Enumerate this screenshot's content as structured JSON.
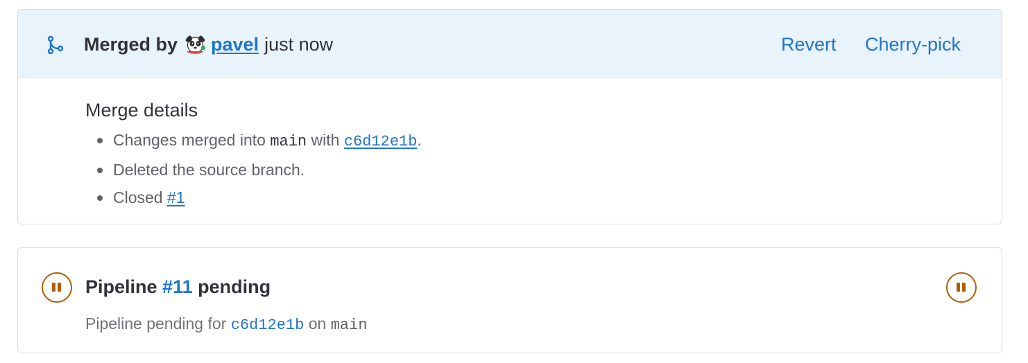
{
  "merged": {
    "label": "Merged by",
    "user": "pavel",
    "time": "just now",
    "actions": {
      "revert": "Revert",
      "cherry_pick": "Cherry-pick"
    }
  },
  "merge_details": {
    "title": "Merge details",
    "item1": {
      "prefix": "Changes merged into",
      "branch": "main",
      "middle": "with",
      "commit": "c6d12e1b",
      "suffix": "."
    },
    "item2": {
      "text": "Deleted the source branch."
    },
    "item3": {
      "prefix": "Closed",
      "issue": "#1"
    }
  },
  "pipeline": {
    "title_prefix": "Pipeline",
    "number": "#11",
    "status": "pending",
    "sub_prefix": "Pipeline pending for",
    "commit": "c6d12e1b",
    "on": "on",
    "branch": "main"
  },
  "colors": {
    "link": "#1f75cb",
    "header_bg": "#e9f3fc",
    "pending": "#b25c00",
    "border": "#dcdcde"
  },
  "icons": {
    "merge": "merge-request-icon",
    "pending": "status-pending-icon"
  }
}
